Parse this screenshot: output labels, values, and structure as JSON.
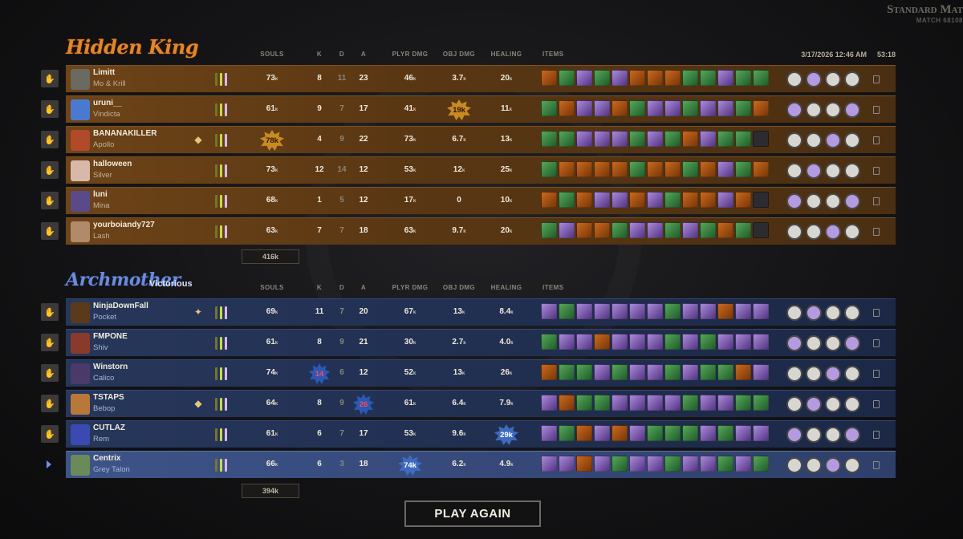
{
  "match": {
    "title": "Standard Mat",
    "subtitle": "MATCH 68108",
    "date": "3/17/2026 12:46 AM",
    "duration": "53:18"
  },
  "headers": {
    "souls": "SOULS",
    "k": "K",
    "d": "D",
    "a": "A",
    "plyr_dmg": "PLYR DMG",
    "obj_dmg": "OBJ DMG",
    "healing": "HEALING",
    "items": "ITEMS"
  },
  "teams": [
    {
      "name": "Hidden King",
      "status": "",
      "total_souls": "416k",
      "players": [
        {
          "name": "Limitt",
          "hero": "Mo & Krill",
          "souls": "73",
          "k": "8",
          "d": "11",
          "a": "23",
          "pdmg": "46",
          "odmg": "3.7",
          "heal": "20",
          "highlight": "",
          "badge": "",
          "avatar": "#6a6a60",
          "items": "ogpgpoooggpgg"
        },
        {
          "name": "uruni__",
          "hero": "Vindicta",
          "souls": "61",
          "k": "9",
          "d": "7",
          "a": "17",
          "pdmg": "41",
          "odmg": "19",
          "heal": "11",
          "highlight": "odmg",
          "badge": "",
          "avatar": "#4a7ad0",
          "items": "goppogppgppgo"
        },
        {
          "name": "BANANAKILLER",
          "hero": "Apollo",
          "souls": "78",
          "k": "4",
          "d": "9",
          "a": "22",
          "pdmg": "73",
          "odmg": "6.7",
          "heal": "13",
          "highlight": "souls",
          "badge": "shield",
          "avatar": "#b04a28",
          "items": "ggpppgpgopgg"
        },
        {
          "name": "halloween",
          "hero": "Silver",
          "souls": "73",
          "k": "12",
          "d": "14",
          "a": "12",
          "pdmg": "53",
          "odmg": "12",
          "heal": "25",
          "highlight": "",
          "badge": "",
          "avatar": "#d8b8a8",
          "items": "goooogoogopgo"
        },
        {
          "name": "luni",
          "hero": "Mina",
          "souls": "68",
          "k": "1",
          "d": "5",
          "a": "12",
          "pdmg": "17",
          "odmg": "0",
          "heal": "10",
          "highlight": "",
          "badge": "",
          "avatar": "#5a4a8a",
          "items": "ogoppopgoopo"
        },
        {
          "name": "yourboiandy727",
          "hero": "Lash",
          "souls": "63",
          "k": "7",
          "d": "7",
          "a": "18",
          "pdmg": "63",
          "odmg": "9.7",
          "heal": "20",
          "highlight": "",
          "badge": "",
          "avatar": "#b08a6a",
          "items": "gpoogppgpgog"
        }
      ]
    },
    {
      "name": "Archmother",
      "status": "Victorious",
      "total_souls": "394k",
      "players": [
        {
          "name": "NinjaDownFall",
          "hero": "Pocket",
          "souls": "69",
          "k": "11",
          "d": "7",
          "a": "20",
          "pdmg": "67",
          "odmg": "13",
          "heal": "8.4",
          "highlight": "",
          "badge": "medal",
          "avatar": "#5a3a1a",
          "items": "pgpppppgppopp"
        },
        {
          "name": "FMPONE",
          "hero": "Shiv",
          "souls": "61",
          "k": "8",
          "d": "9",
          "a": "21",
          "pdmg": "30",
          "odmg": "2.7",
          "heal": "4.0",
          "highlight": "",
          "badge": "",
          "avatar": "#8a3a2a",
          "items": "gppopppgpgppp"
        },
        {
          "name": "Winstorn",
          "hero": "Calico",
          "souls": "74",
          "k": "14",
          "d": "6",
          "a": "12",
          "pdmg": "52",
          "odmg": "13",
          "heal": "26",
          "highlight": "k",
          "badge": "",
          "avatar": "#4a3a6a",
          "items": "oggpgppgpggop"
        },
        {
          "name": "TSTAPS",
          "hero": "Bebop",
          "souls": "64",
          "k": "8",
          "d": "9",
          "a": "26",
          "pdmg": "61",
          "odmg": "6.4",
          "heal": "7.9",
          "highlight": "a",
          "badge": "shield",
          "avatar": "#b8783a",
          "items": "poggppppgppgg"
        },
        {
          "name": "CUTLAZ",
          "hero": "Rem",
          "souls": "61",
          "k": "6",
          "d": "7",
          "a": "17",
          "pdmg": "53",
          "odmg": "9.6",
          "heal": "29",
          "highlight": "heal",
          "badge": "",
          "avatar": "#3a4ab0",
          "items": "pgopopgggpgpp"
        },
        {
          "name": "Centrix",
          "hero": "Grey Talon",
          "souls": "66",
          "k": "6",
          "d": "3",
          "a": "18",
          "pdmg": "74",
          "odmg": "6.2",
          "heal": "4.9",
          "highlight": "pdmg",
          "badge": "",
          "avatar": "#6a8a5a",
          "items": "ppopgppgppgpg"
        }
      ]
    }
  ],
  "unit": "k",
  "play_again": "PLAY AGAIN"
}
